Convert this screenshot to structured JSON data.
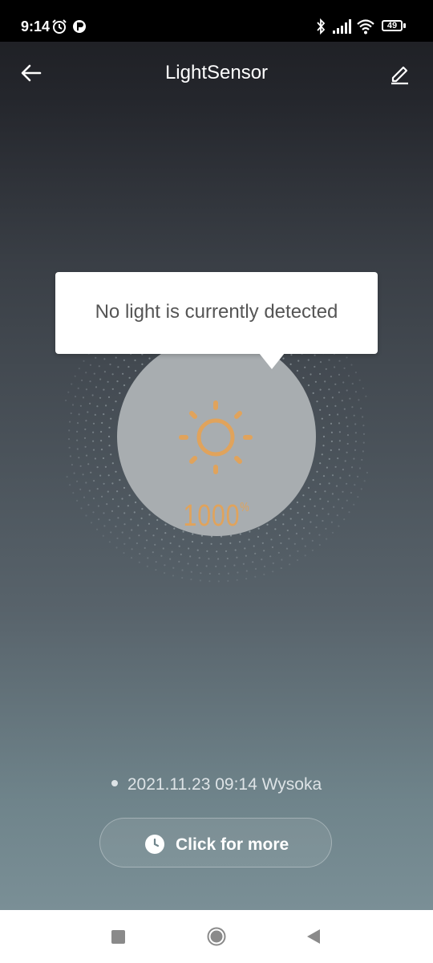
{
  "status_bar": {
    "time": "9:14",
    "battery_level": "49",
    "icons": [
      "alarm-icon",
      "app-notification-icon",
      "bluetooth-icon",
      "signal-icon",
      "wifi-icon",
      "battery-icon"
    ]
  },
  "header": {
    "title": "LightSensor",
    "back_icon": "arrow-left-icon",
    "edit_icon": "pencil-icon"
  },
  "sensor": {
    "icon": "sun-icon",
    "value": "1000",
    "unit": "%",
    "accent_color": "#e0a35c"
  },
  "tooltip": {
    "text": "No light is currently detected"
  },
  "status": {
    "text": "2021.11.23 09:14 Wysoka"
  },
  "more_button": {
    "label": "Click for more",
    "icon": "clock-icon"
  },
  "nav_bar": {
    "icons": [
      "square-recents-icon",
      "circle-home-icon",
      "triangle-back-icon"
    ]
  }
}
